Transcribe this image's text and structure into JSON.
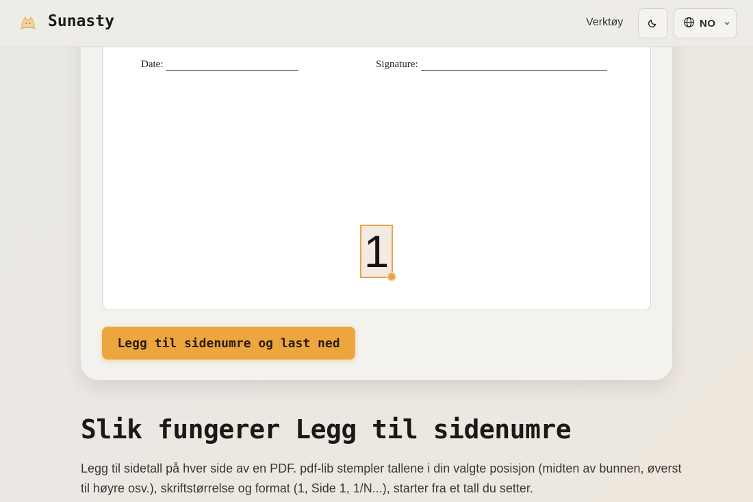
{
  "header": {
    "brand": "Sunasty",
    "nav_tools": "Verktøy",
    "theme_icon": "moon-icon",
    "language": {
      "icon": "globe-icon",
      "code": "NO",
      "chevron": "chevron-down-icon"
    }
  },
  "preview": {
    "date_label": "Date:",
    "signature_label": "Signature:",
    "page_number": "1"
  },
  "actions": {
    "add_and_download": "Legg til sidenumre og last ned"
  },
  "info": {
    "title": "Slik fungerer Legg til sidenumre",
    "description": "Legg til sidetall på hver side av en PDF. pdf-lib stempler tallene i din valgte posisjon (midten av bunnen, øverst til høyre osv.), skriftstørrelse og format (1, Side 1, 1/N...), starter fra et tall du setter."
  },
  "colors": {
    "accent": "#eda63e",
    "background": "#ebe9e4",
    "card": "#f3f2ee"
  }
}
